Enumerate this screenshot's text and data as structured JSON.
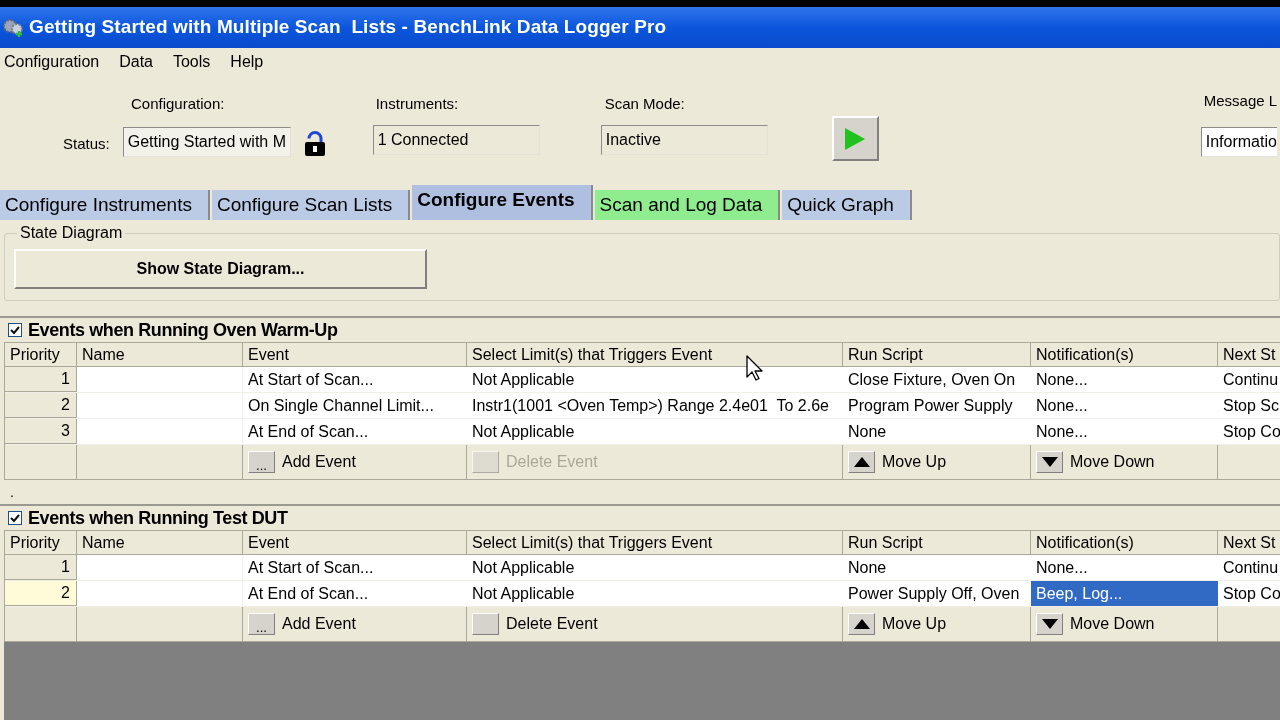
{
  "window": {
    "title": "Getting Started with Multiple Scan  Lists - BenchLink Data Logger Pro"
  },
  "menu": [
    "Configuration",
    "Data",
    "Tools",
    "Help"
  ],
  "toolbar": {
    "configuration_label": "Configuration:",
    "status_label": "Status:",
    "status_value": "Getting Started with M",
    "locked": false,
    "instruments_label": "Instruments:",
    "instruments_value": "1 Connected",
    "scan_mode_label": "Scan Mode:",
    "scan_mode_value": "Inactive",
    "message_label": "Message L",
    "message_value": "Informatio"
  },
  "tabs": [
    {
      "label": "Configure Instruments",
      "selected": false,
      "color": "#bccbe5"
    },
    {
      "label": "Configure Scan Lists",
      "selected": false,
      "color": "#bccbe5"
    },
    {
      "label": "Configure Events",
      "selected": true,
      "color": "#aebfdf"
    },
    {
      "label": "Scan and Log Data",
      "selected": false,
      "color": "#8fec8f"
    },
    {
      "label": "Quick Graph",
      "selected": false,
      "color": "#bccbe5"
    }
  ],
  "state_diagram": {
    "legend": "State Diagram",
    "button": "Show State Diagram..."
  },
  "event_groups": [
    {
      "title": "Events when Running Oven Warm-Up",
      "checked": true,
      "columns": [
        "Priority",
        "Name",
        "Event",
        "Select Limit(s) that Triggers Event",
        "Run Script",
        "Notification(s)",
        "Next St"
      ],
      "rows": [
        {
          "priority": "1",
          "event": "At Start of Scan...",
          "limits": "Not Applicable",
          "run_script": "Close Fixture, Oven On",
          "notifications": "None...",
          "next_step": "Continu",
          "selected": false
        },
        {
          "priority": "2",
          "event": "On Single Channel Limit...",
          "limits": "Instr1(1001 <Oven Temp>) Range 2.4e01  To 2.6e",
          "run_script": "Program Power Supply",
          "notifications": "None...",
          "next_step": "Stop Sc",
          "selected": false
        },
        {
          "priority": "3",
          "event": "At End of Scan...",
          "limits": "Not Applicable",
          "run_script": "None",
          "notifications": "None...",
          "next_step": "Stop Co",
          "selected": false
        }
      ],
      "actions": [
        {
          "kind": "add",
          "key_text": "...",
          "label": "Add Event",
          "disabled": false
        },
        {
          "kind": "delete",
          "label": "Delete Event",
          "disabled": true
        },
        {
          "kind": "up",
          "label": "Move Up",
          "disabled": false
        },
        {
          "kind": "down",
          "label": "Move Down",
          "disabled": false
        }
      ]
    },
    {
      "title": "Events when Running Test DUT",
      "checked": true,
      "columns": [
        "Priority",
        "Name",
        "Event",
        "Select Limit(s) that Triggers Event",
        "Run Script",
        "Notification(s)",
        "Next St"
      ],
      "rows": [
        {
          "priority": "1",
          "event": "At Start of Scan...",
          "limits": "Not Applicable",
          "run_script": "None",
          "notifications": "None...",
          "next_step": "Continu",
          "selected": false
        },
        {
          "priority": "2",
          "event": "At End of Scan...",
          "limits": "Not Applicable",
          "run_script": "Power Supply Off, Oven",
          "notifications": "Beep, Log...",
          "next_step": "Stop Co",
          "selected": true
        }
      ],
      "actions": [
        {
          "kind": "add",
          "key_text": "...",
          "label": "Add Event",
          "disabled": false
        },
        {
          "kind": "delete",
          "label": "Delete Event",
          "disabled": false
        },
        {
          "kind": "up",
          "label": "Move Up",
          "disabled": false
        },
        {
          "kind": "down",
          "label": "Move Down",
          "disabled": false
        }
      ]
    }
  ],
  "divider_mark": "."
}
